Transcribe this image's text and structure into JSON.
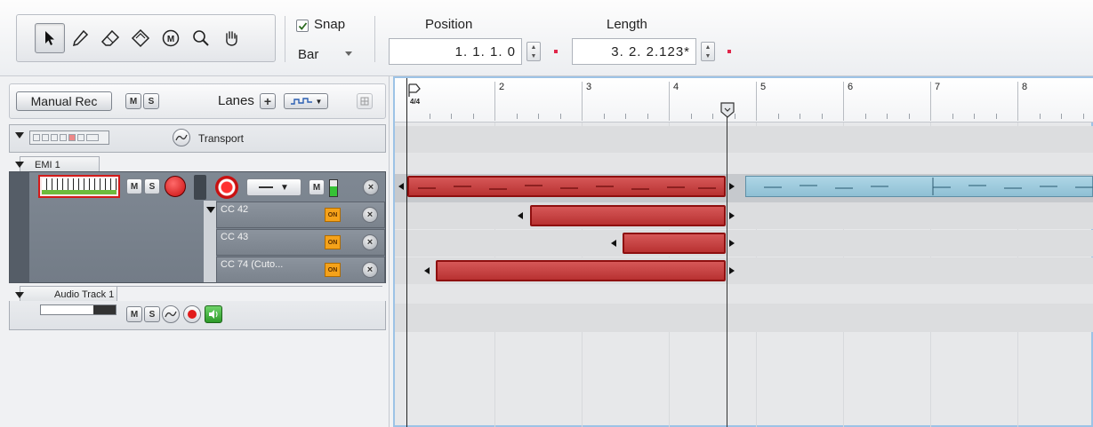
{
  "toolbar": {
    "tools": [
      "arrow-tool",
      "pencil-tool",
      "eraser-tool",
      "paint-tool",
      "mute-tool",
      "zoom-tool",
      "hand-tool"
    ],
    "snap": {
      "label": "Snap",
      "checked": true,
      "value": "Bar"
    },
    "position": {
      "label": "Position",
      "value": "1. 1. 1.   0"
    },
    "length": {
      "label": "Length",
      "value": "3.  2.  2.123*"
    }
  },
  "tracklist_header": {
    "manual_rec_label": "Manual Rec",
    "mute_label": "M",
    "solo_label": "S",
    "lanes_label": "Lanes",
    "add_lane_label": "+"
  },
  "tracks": {
    "transport": {
      "name": "Transport"
    },
    "emi": {
      "name": "EMI 1",
      "mute_label": "M",
      "solo_label": "S",
      "lane_mute_label": "M",
      "lanes": [
        {
          "name": "CC 42",
          "on_label": "ON"
        },
        {
          "name": "CC 43",
          "on_label": "ON"
        },
        {
          "name": "CC 74 (Cuto...",
          "on_label": "ON"
        }
      ]
    },
    "audio": {
      "name": "Audio Track 1",
      "mute_label": "M",
      "solo_label": "S"
    }
  },
  "ruler": {
    "bars": [
      "2",
      "3",
      "4",
      "5",
      "6",
      "7",
      "8"
    ],
    "time_signature": "4/4"
  },
  "colors": {
    "clip_red": "#c24040",
    "clip_blue": "#9fcadc",
    "selection_border": "#9dc3e6",
    "record_red": "#e02020"
  }
}
